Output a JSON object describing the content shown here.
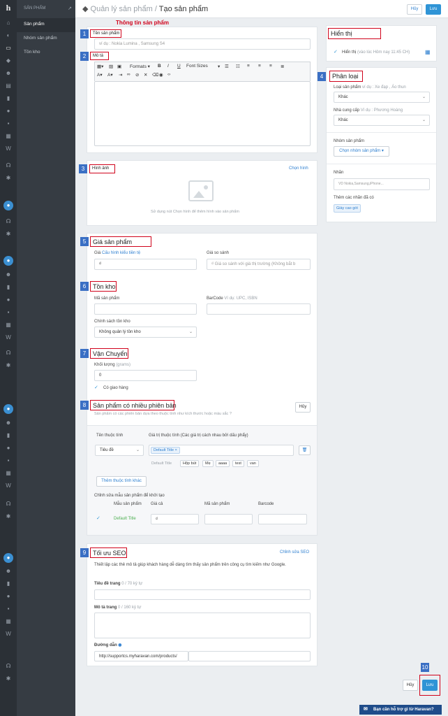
{
  "sidebar": {
    "title": "SẢN PHẨM",
    "items": [
      {
        "label": "Sản phẩm"
      },
      {
        "label": "Nhóm sản phẩm"
      },
      {
        "label": "Tồn kho"
      }
    ]
  },
  "header": {
    "breadcrumb_parent": "Quản lý sản phẩm",
    "breadcrumb_sep": "/",
    "breadcrumb_current": "Tạo sản phẩm",
    "cancel_label": "Hủy",
    "save_label": "Lưu"
  },
  "annotation_title": "Thông tin sản phẩm",
  "numbers": [
    "1",
    "2",
    "3",
    "4",
    "5",
    "6",
    "7",
    "8",
    "9",
    "10"
  ],
  "info": {
    "name_label": "Tên sản phẩm",
    "name_placeholder": "ví dụ : Nokia Lumina , Samsung S4",
    "desc_label": "Mô tả",
    "toolbar": {
      "formats": "Formats",
      "font_size": "Font Sizes",
      "bold": "B",
      "italic": "I",
      "underline": "U"
    }
  },
  "images": {
    "label": "Hình ảnh",
    "choose": "Chọn hình",
    "hint": "Sử dụng nút Chọn hình để thêm hình vào sản phẩm"
  },
  "pricing": {
    "title": "Giá sản phẩm",
    "price_label": "Giá",
    "price_link": "Cấu hình kiểu tiền tệ",
    "price_value": "₫",
    "compare_label": "Giá so sánh",
    "compare_placeholder": "₫  Giá so sánh với giá thị trường (Không bắt b"
  },
  "inventory": {
    "title": "Tồn kho",
    "sku_label": "Mã sản phẩm",
    "barcode_label": "BarCode",
    "barcode_hint": "Ví dụ: UPC, ISBN",
    "policy_label": "Chính sách tồn kho",
    "policy_value": "Không quản lý tồn kho"
  },
  "shipping": {
    "title": "Vận Chuyển",
    "weight_label": "Khối lượng",
    "weight_unit": "(grams)",
    "weight_value": "0",
    "requires_label": "Có giao hàng"
  },
  "variants": {
    "title": "Sản phẩm có nhiều phiên bản",
    "desc": "Sản phẩm có các phiên bản dựa theo thuộc tính như kích thước hoặc màu sắc ?",
    "cancel": "Hủy",
    "attr_name_label": "Tên thuộc tính",
    "attr_values_label": "Giá trị thuộc tính (Các giá trị cách nhau bởi dấu phẩy)",
    "attr_name_value": "Tiêu đề",
    "tag_value": "Default Title",
    "tag_x": "×",
    "suggest": [
      "Default Title",
      "Hộp bút",
      "Mẹ",
      "aaaa",
      "test",
      "van"
    ],
    "add_attr": "Thêm thuộc tính khác",
    "edit_label": "Chỉnh sửa mẫu sản phẩm để khởi tạo",
    "col_variant": "Mẫu sản phẩm",
    "col_price": "Giá cả",
    "col_sku": "Mã sản phẩm",
    "col_barcode": "Barcode",
    "row_title": "Default Title",
    "row_price": "₫"
  },
  "seo": {
    "title": "Tối ưu SEO",
    "edit": "Chỉnh sửa SEO",
    "desc": "Thiết lập các thẻ mô tả giúp khách hàng dễ dàng tìm thấy sản phẩm trên công cụ tìm kiếm như Google.",
    "page_title_label": "Tiêu đề trang",
    "page_title_count": "0 / 70 ký tự",
    "meta_label": "Mô tả trang",
    "meta_count": "0 / 160 ký tự",
    "url_label": "Đường dẫn",
    "url_value": "http://supportcs.myharavan.com/products/"
  },
  "visibility": {
    "title": "Hiển thị",
    "label": "Hiển thị",
    "hint": "(vào lúc Hôm nay 11:45 CH)"
  },
  "classification": {
    "title": "Phân loại",
    "type_label": "Loại sản phẩm",
    "type_hint": "ví dụ : Xe đạp , Áo thun",
    "type_value": "Khác",
    "vendor_label": "Nhà cung cấp",
    "vendor_hint": "Ví dụ : Phương Hoàng",
    "vendor_value": "Khác",
    "collection_label": "Nhóm sản phẩm",
    "collection_button": "Chọn nhóm sản phẩm ▾",
    "tags_label": "Nhãn",
    "tags_placeholder": "VD Nokia,Samsung,iPhone...",
    "existing_label": "Thêm các nhãn đã có",
    "existing_tag": "Giày cao gót"
  },
  "footer": {
    "cancel": "Hủy",
    "save": "Lưu",
    "help": "Bạn cần hỗ trợ gì từ Haravan?"
  }
}
